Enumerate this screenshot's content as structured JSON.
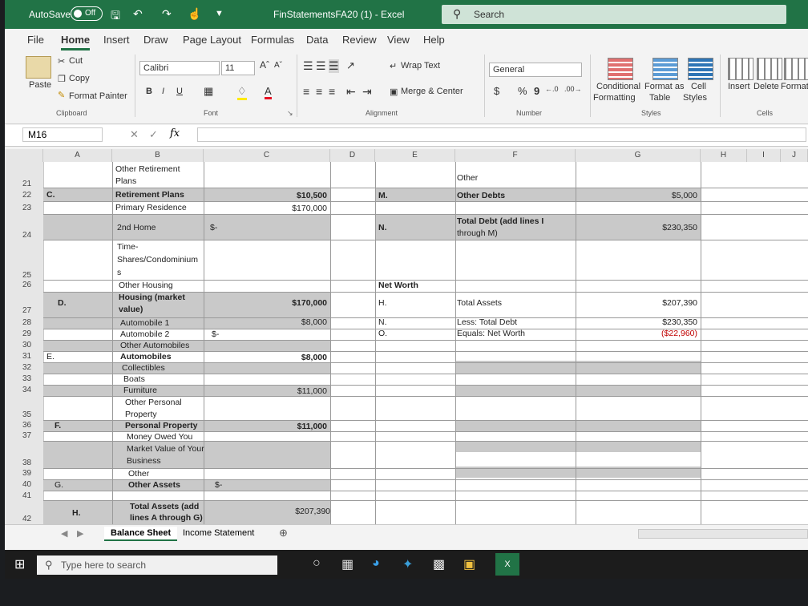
{
  "titlebar": {
    "autosave_label": "AutoSave",
    "autosave_state": "Off",
    "document_title": "FinStatementsFA20 (1)  -  Excel",
    "search_placeholder": "Search"
  },
  "tabs": [
    "File",
    "Home",
    "Insert",
    "Draw",
    "Page Layout",
    "Formulas",
    "Data",
    "Review",
    "View",
    "Help"
  ],
  "ribbon": {
    "clipboard": {
      "paste": "Paste",
      "cut": "Cut",
      "copy": "Copy",
      "format_painter": "Format Painter",
      "group": "Clipboard"
    },
    "font": {
      "name": "Calibri",
      "size": "11",
      "bold": "B",
      "italic": "I",
      "underline": "U",
      "group": "Font"
    },
    "alignment": {
      "wrap": "Wrap Text",
      "merge": "Merge & Center",
      "group": "Alignment"
    },
    "number": {
      "format": "General",
      "currency": "$",
      "percent": "%",
      "comma": "9",
      "group": "Number"
    },
    "styles": {
      "conditional": "Conditional",
      "conditional2": "Formatting",
      "format_as": "Format as",
      "table": "Table",
      "cell": "Cell",
      "cell_styles": "Styles",
      "group": "Styles"
    },
    "cells": {
      "insert": "Insert",
      "delete": "Delete",
      "format": "Format",
      "group": "Cells"
    }
  },
  "formula_bar": {
    "name_box": "M16",
    "fx": "fx"
  },
  "columns": [
    "A",
    "B",
    "C",
    "D",
    "E",
    "F",
    "G",
    "H",
    "I",
    "J"
  ],
  "rows": {
    "r21": "21",
    "r22": "22",
    "r23": "23",
    "r24": "24",
    "r25": "25",
    "r26": "26",
    "r27": "27",
    "r28": "28",
    "r29": "29",
    "r30": "30",
    "r31": "31",
    "r32": "32",
    "r33": "33",
    "r34": "34",
    "r35": "35",
    "r36": "36",
    "r37": "37",
    "r38": "38",
    "r39": "39",
    "r40": "40",
    "r41": "41",
    "r42": "42"
  },
  "cells": {
    "b21a": "Other Retirement",
    "b21b": "Plans",
    "a22": "C.",
    "b22": "Retirement Plans",
    "c22": "$10,500",
    "b23": "Primary Residence",
    "c23": "$170,000",
    "b24": "2nd Home",
    "c24": "$-",
    "b25a": "Time-",
    "b25b": "Shares/Condominium",
    "b25c": "s",
    "b26": "Other Housing",
    "a27": "D.",
    "b27a": "Housing (market",
    "b27b": "value)",
    "c27": "$170,000",
    "b28": "Automobile 1",
    "c28": "$8,000",
    "b29": "Automobile 2",
    "c29": "$-",
    "b30": "Other Automobiles",
    "a31": "E.",
    "b31": "Automobiles",
    "c31": "$8,000",
    "b32": "Collectibles",
    "b33": "Boats",
    "b34": "Furniture",
    "c34": "$11,000",
    "b35a": "Other Personal",
    "b35b": "Property",
    "a36": "F.",
    "b36": "Personal Property",
    "c36": "$11,000",
    "b37": "Money Owed You",
    "b38a": "Market Value of Your",
    "b38b": "Business",
    "b39": "Other",
    "a40": "G.",
    "b40": "Other Assets",
    "c40": "$-",
    "a42": "H.",
    "b42a": "Total Assets (add",
    "b42b": "lines A through G)",
    "c42": "$207,390",
    "f21": "Other",
    "e22": "M.",
    "f22": "Other Debts",
    "g22": "$5,000",
    "e24": "N.",
    "f24a": "Total Debt (add lines I",
    "f24b": "through M)",
    "g24": "$230,350",
    "e26": "Net Worth",
    "e27": "H.",
    "f27": "Total Assets",
    "g27": "$207,390",
    "e28": "N.",
    "f28": "Less: Total Debt",
    "g28": "$230,350",
    "e29": "O.",
    "f29": "Equals: Net Worth",
    "g29": "($22,960)"
  },
  "sheets": [
    "Balance Sheet",
    "Income Statement"
  ],
  "taskbar": {
    "search_placeholder": "Type here to search"
  }
}
